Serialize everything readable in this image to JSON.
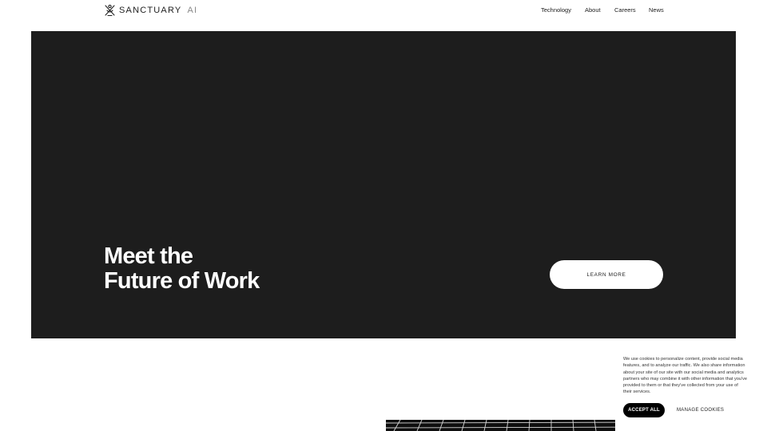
{
  "header": {
    "logo_text": "SANCTUARY",
    "logo_suffix": "AI",
    "nav": [
      {
        "label": "Technology"
      },
      {
        "label": "About"
      },
      {
        "label": "Careers"
      },
      {
        "label": "News"
      }
    ]
  },
  "hero": {
    "title_line1": "Meet the",
    "title_line2": "Future of Work",
    "cta_label": "LEARN MORE",
    "background_color": "#1d1d1d"
  },
  "cookie_banner": {
    "text": "We use cookies to personalize content, provide social media features, and to analyze our traffic. We also share information about your site of our site with our social media and analytics partners who may combine it with other information that you've provided to them or that they've collected from your use of their services.",
    "accept_label": "ACCEPT ALL",
    "manage_label": "MANAGE COOKIES"
  }
}
